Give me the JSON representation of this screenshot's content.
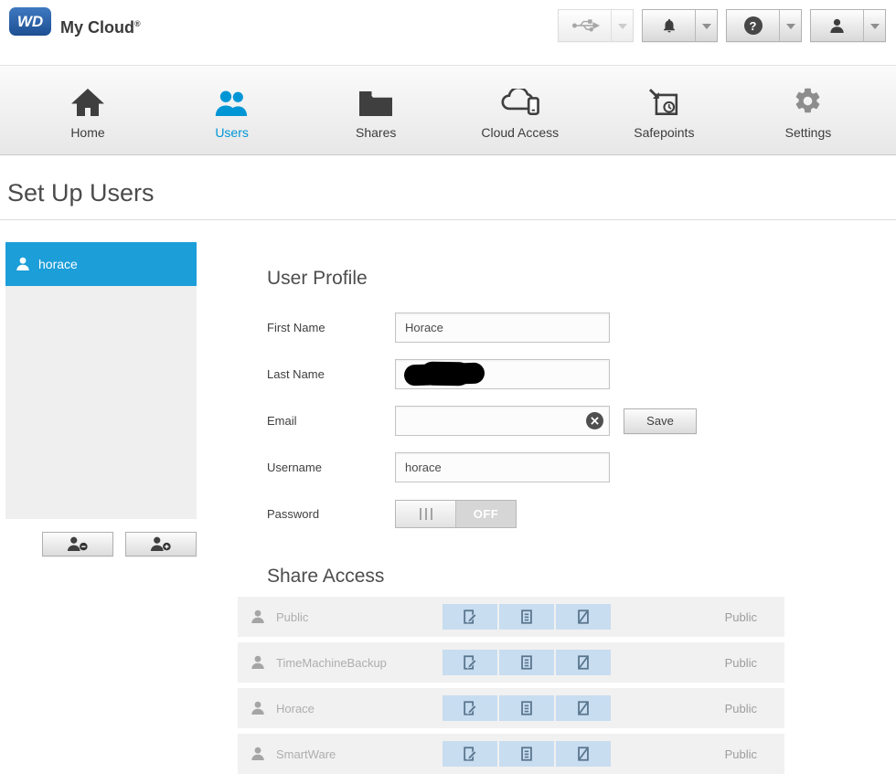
{
  "header": {
    "logo_text": "WD",
    "product_name": "My Cloud",
    "registered_mark": "®",
    "toolbar": {
      "usb_icon": "usb-device",
      "alert_icon": "alerts",
      "help_icon": "help",
      "help_glyph": "?",
      "user_icon": "user"
    }
  },
  "nav": {
    "items": [
      {
        "label": "Home"
      },
      {
        "label": "Users",
        "active": true
      },
      {
        "label": "Shares"
      },
      {
        "label": "Cloud Access"
      },
      {
        "label": "Safepoints"
      },
      {
        "label": "Settings"
      }
    ]
  },
  "page": {
    "title": "Set Up Users"
  },
  "user_list": {
    "selected_user": "horace"
  },
  "profile": {
    "heading": "User Profile",
    "first_name": {
      "label": "First Name",
      "value": "Horace"
    },
    "last_name": {
      "label": "Last Name",
      "value": "",
      "redacted": true
    },
    "email": {
      "label": "Email",
      "value": "",
      "save_label": "Save"
    },
    "username": {
      "label": "Username",
      "value": "horace"
    },
    "password": {
      "label": "Password",
      "state": "OFF"
    }
  },
  "share_access": {
    "heading": "Share Access",
    "rows": [
      {
        "name": "Public",
        "access": "Public"
      },
      {
        "name": "TimeMachineBackup",
        "access": "Public"
      },
      {
        "name": "Horace",
        "access": "Public"
      },
      {
        "name": "SmartWare",
        "access": "Public"
      }
    ]
  },
  "colors": {
    "accent_blue": "#0096d6",
    "selected_row_blue": "#1c9ed9",
    "segment_bg": "#c8ddf0",
    "segment_icon": "#5a768e"
  }
}
